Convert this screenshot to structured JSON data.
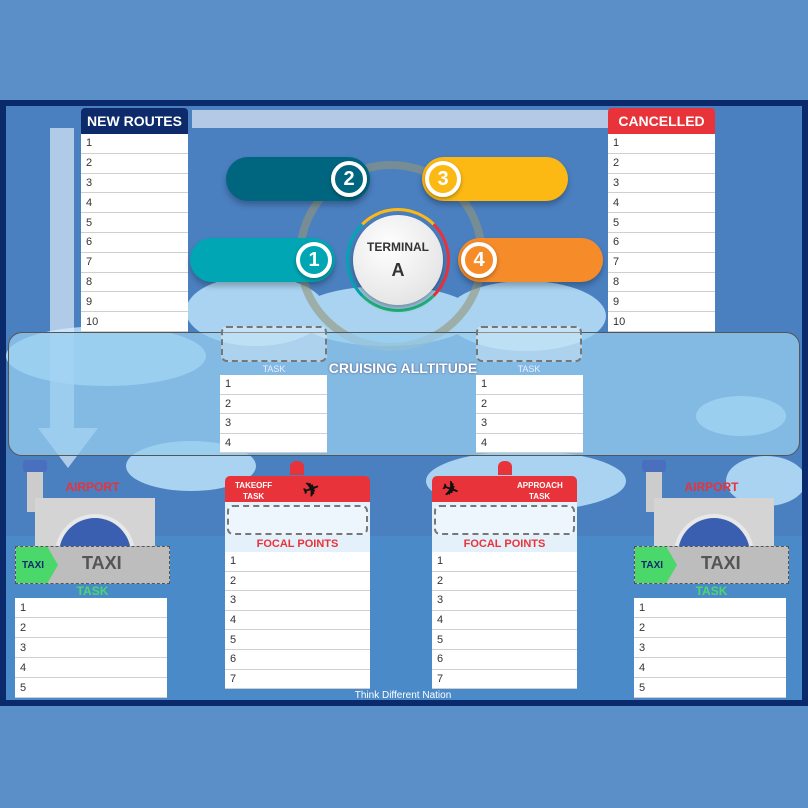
{
  "new_routes": {
    "title": "NEW ROUTES",
    "items": [
      "1",
      "2",
      "3",
      "4",
      "5",
      "6",
      "7",
      "8",
      "9",
      "10"
    ]
  },
  "cancelled": {
    "title": "CANCELLED",
    "items": [
      "1",
      "2",
      "3",
      "4",
      "5",
      "6",
      "7",
      "8",
      "9",
      "10"
    ]
  },
  "terminal": {
    "label": "TERMINAL",
    "letter": "A",
    "steps": [
      {
        "num": "1",
        "color": "#00a6b4"
      },
      {
        "num": "2",
        "color": "#006680"
      },
      {
        "num": "3",
        "color": "#fdb913"
      },
      {
        "num": "4",
        "color": "#f68b2a"
      }
    ]
  },
  "cruising": {
    "title": "CRUISING ALLTITUDE",
    "left_task": {
      "label": "TASK",
      "items": [
        "1",
        "2",
        "3",
        "4"
      ]
    },
    "right_task": {
      "label": "TASK",
      "items": [
        "1",
        "2",
        "3",
        "4"
      ]
    }
  },
  "takeoff": {
    "line1": "TAKEOFF",
    "line2": "TASK",
    "focal": "FOCAL POINTS",
    "items": [
      "1",
      "2",
      "3",
      "4",
      "5",
      "6",
      "7"
    ]
  },
  "approach": {
    "line1": "APPROACH",
    "line2": "TASK",
    "focal": "FOCAL POINTS",
    "items": [
      "1",
      "2",
      "3",
      "4",
      "5",
      "6",
      "7"
    ]
  },
  "airport_left": {
    "sign": "AIRPORT",
    "taxi_tag": "TAXI",
    "taxi_big": "TAXI",
    "task": "TASK",
    "items": [
      "1",
      "2",
      "3",
      "4",
      "5"
    ]
  },
  "airport_right": {
    "sign": "AIRPORT",
    "taxi_tag": "TAXI",
    "taxi_big": "TAXI",
    "task": "TASK",
    "items": [
      "1",
      "2",
      "3",
      "4",
      "5"
    ]
  },
  "footer": "Think Different Nation",
  "colors": {
    "navy": "#0d2b6b",
    "red": "#e8333a",
    "green": "#4ad86a"
  }
}
